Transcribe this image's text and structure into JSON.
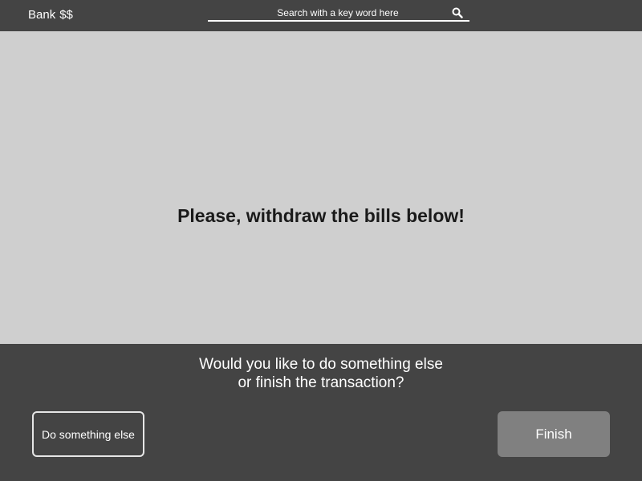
{
  "header": {
    "brand": "Bank",
    "brand_symbol": "$$",
    "search": {
      "placeholder": "Search with a key word here",
      "icon": "search-icon"
    }
  },
  "main": {
    "headline": "Please, withdraw the bills below!"
  },
  "footer": {
    "prompt_line1": "Would you like to do something else",
    "prompt_line2": "or finish the transaction?",
    "do_something_else_label": "Do something else",
    "finish_label": "Finish"
  },
  "colors": {
    "bar_background": "#444444",
    "content_background": "#cfcfcf",
    "finish_button": "#808080"
  }
}
